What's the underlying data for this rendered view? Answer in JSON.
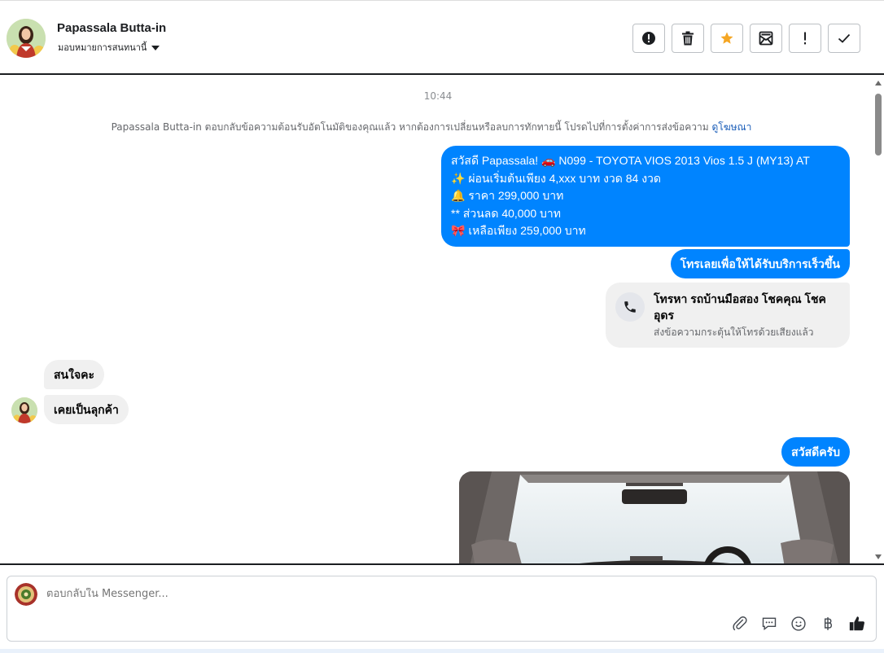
{
  "header": {
    "contact_name": "Papassala Butta-in",
    "assign_label": "มอบหมายการสนทนานี้",
    "actions": [
      {
        "name": "report-spam-button",
        "icon": "alert-circle-icon"
      },
      {
        "name": "delete-button",
        "icon": "trash-icon"
      },
      {
        "name": "star-button",
        "icon": "star-icon"
      },
      {
        "name": "mark-unread-button",
        "icon": "envelope-open-icon"
      },
      {
        "name": "follow-up-button",
        "icon": "exclamation-icon"
      },
      {
        "name": "mark-done-button",
        "icon": "check-icon"
      }
    ],
    "star_color": "#f5a623"
  },
  "conversation": {
    "time": "10:44",
    "notice_text": "Papassala Butta-in ตอบกลับข้อความต้อนรับอัตโนมัติของคุณแล้ว หากต้องการเปลี่ยนหรือลบการทักทายนี้ โปรดไปที่การตั้งค่าการส่งข้อความ",
    "notice_link": "ดูโฆษณา",
    "outgoing_message_1": {
      "lines": [
        "สวัสดี Papassala! 🚗 N099 - TOYOTA VIOS 2013 Vios 1.5 J (MY13) AT",
        "✨ ผ่อนเริ่มต้นเพียง 4,xxx บาท งวด 84 งวด",
        "🔔  ราคา 299,000 บาท",
        "** ส่วนลด 40,000 บาท",
        "🎀 เหลือเพียง 259,000 บาท"
      ]
    },
    "outgoing_message_2": "โทรเลยเพื่อให้ได้รับบริการเร็วขึ้น",
    "call_card": {
      "title": "โทรหา รถบ้านมือสอง โชคคุณ โชคอุดร",
      "subtitle": "ส่งข้อความกระตุ้นให้โทรด้วยเสียงแล้ว"
    },
    "incoming_1": "สนใจคะ",
    "incoming_2": "เคยเป็นลุกค้า",
    "outgoing_message_3": "สวัสดีครับ",
    "outgoing_color": "#0084ff"
  },
  "composer": {
    "placeholder": "ตอบกลับใน Messenger...",
    "tools": [
      "paperclip-icon",
      "quick-reply-icon",
      "emoji-icon",
      "baht-icon",
      "thumbs-up-icon"
    ]
  }
}
